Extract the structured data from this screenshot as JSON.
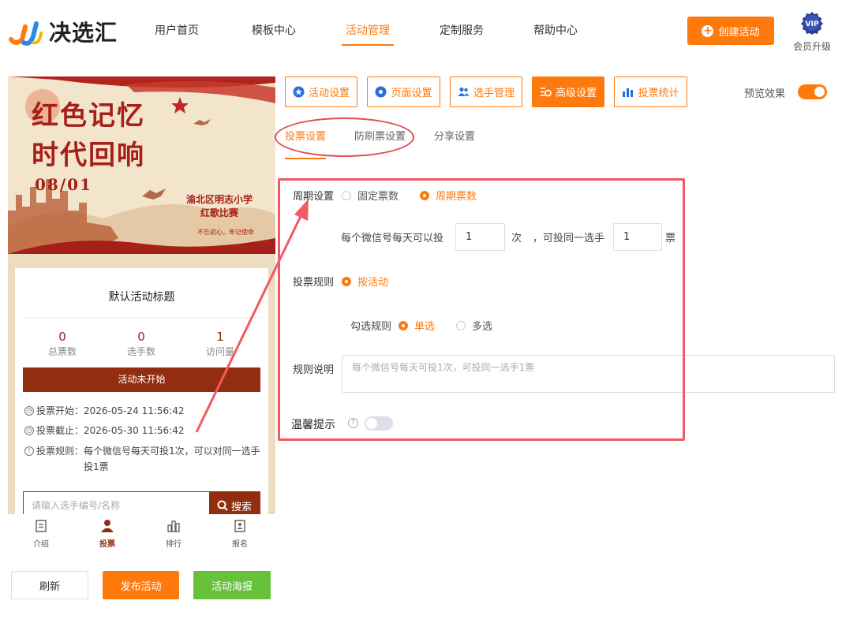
{
  "header": {
    "logo_text": "决选汇",
    "nav": [
      {
        "label": "用户首页"
      },
      {
        "label": "模板中心"
      },
      {
        "label": "活动管理"
      },
      {
        "label": "定制服务"
      },
      {
        "label": "帮助中心"
      }
    ],
    "active_nav": "活动管理",
    "create_button": "创建活动",
    "vip_badge": "VIP",
    "vip_label": "会员升级"
  },
  "preview": {
    "banner": {
      "title_line1": "红色记忆",
      "title_line2": "时代回响",
      "date": "08/01",
      "school_line1": "渝北区明志小学",
      "school_line2": "红歌比赛",
      "slogan": "不忘初心，牢记使命"
    },
    "card_title": "默认活动标题",
    "stats": [
      {
        "value": "0",
        "label": "总票数"
      },
      {
        "value": "0",
        "label": "选手数"
      },
      {
        "value": "1",
        "label": "访问量"
      }
    ],
    "status": "活动未开始",
    "vote_start_label": "投票开始：",
    "vote_start": "2026-05-24 11:56:42",
    "vote_end_label": "投票截止：",
    "vote_end": "2026-05-30 11:56:42",
    "vote_rule_label": "投票规则：",
    "vote_rule": "每个微信号每天可投1次，可以对同一选手投1票",
    "search_placeholder": "请输入选手编号/名称",
    "search_button": "搜索",
    "tabbar": [
      {
        "label": "介绍",
        "icon": "intro-icon"
      },
      {
        "label": "投票",
        "icon": "vote-person-icon"
      },
      {
        "label": "排行",
        "icon": "ranking-icon"
      },
      {
        "label": "报名",
        "icon": "signup-icon"
      }
    ]
  },
  "actions": {
    "refresh": "刷新",
    "publish": "发布活动",
    "poster": "活动海报"
  },
  "settings": {
    "top_tabs": [
      {
        "label": "活动设置",
        "icon": "star-circle-icon"
      },
      {
        "label": "页面设置",
        "icon": "palette-icon"
      },
      {
        "label": "选手管理",
        "icon": "users-icon"
      },
      {
        "label": "高级设置",
        "icon": "advanced-gear-icon"
      },
      {
        "label": "投票统计",
        "icon": "bar-stats-icon"
      }
    ],
    "active_top_tab": "高级设置",
    "preview_label": "预览效果",
    "preview_on": true,
    "sub_tabs": [
      {
        "label": "投票设置"
      },
      {
        "label": "防刷票设置"
      },
      {
        "label": "分享设置"
      }
    ],
    "active_sub_tab": "投票设置",
    "period_label": "周期设置",
    "period_options": [
      {
        "label": "固定票数",
        "checked": false
      },
      {
        "label": "周期票数",
        "checked": true
      }
    ],
    "daily_text_1": "每个微信号每天可以投",
    "daily_times": "1",
    "daily_text_2": "次",
    "daily_text_3": "，可投同一选手",
    "same_player_votes": "1",
    "daily_text_4": "票",
    "rule_label": "投票规则",
    "rule_option": "按活动",
    "select_rule_label": "勾选规则",
    "select_options": [
      {
        "label": "单选",
        "checked": true
      },
      {
        "label": "多选",
        "checked": false
      }
    ],
    "desc_label": "规则说明",
    "desc_placeholder": "每个微信号每天可投1次，可投同一选手1票",
    "tip_label": "温馨提示",
    "tip_on": false
  },
  "colors": {
    "accent": "#ff7a0c",
    "theme_red": "#922d0f",
    "annotation_red": "#f05a62",
    "green": "#67c23a"
  }
}
